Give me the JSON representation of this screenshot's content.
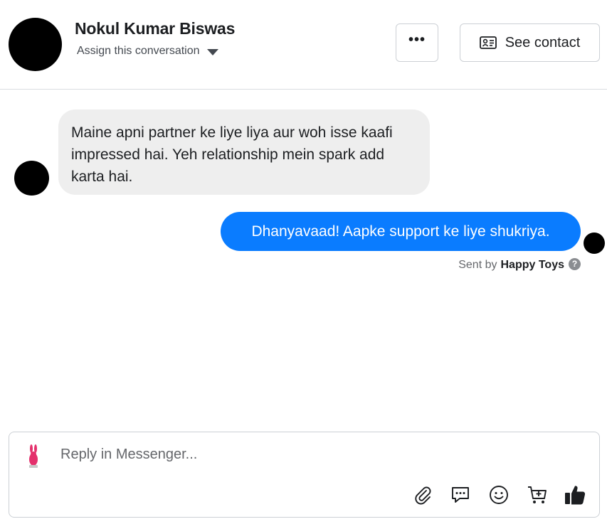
{
  "header": {
    "contact_name": "Nokul Kumar Biswas",
    "assign_label": "Assign this conversation",
    "more_label": "•••",
    "see_contact_label": "See contact"
  },
  "messages": [
    {
      "direction": "incoming",
      "text": "Maine apni partner ke liye liya aur woh isse kaafi impressed hai. Yeh relationship mein spark add karta hai."
    },
    {
      "direction": "outgoing",
      "text": "Dhanyavaad! Aapke support ke liye shukriya."
    }
  ],
  "sent_by": {
    "prefix": "Sent by",
    "page_name": "Happy Toys",
    "help_glyph": "?"
  },
  "composer": {
    "placeholder": "Reply in Messenger...",
    "tools": [
      "paperclip-icon",
      "saved-reply-icon",
      "emoji-icon",
      "cart-icon",
      "thumbs-up-icon"
    ]
  },
  "colors": {
    "outgoing_bubble": "#0a7cff",
    "incoming_bubble": "#eeeeee",
    "text": "#1c1e21",
    "muted": "#65676b"
  }
}
